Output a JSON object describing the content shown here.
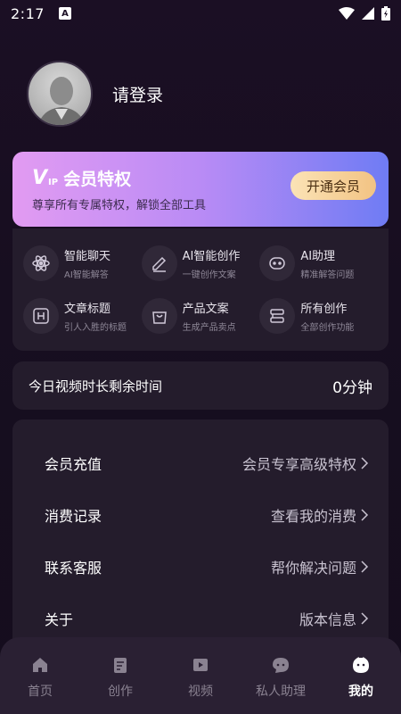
{
  "status_bar": {
    "time": "2:17",
    "badge": "A"
  },
  "profile": {
    "login_text": "请登录"
  },
  "vip": {
    "logo_v": "V",
    "logo_ip": "IP",
    "title": "会员特权",
    "subtitle": "尊享所有专属特权，解锁全部工具",
    "button": "开通会员",
    "gradient": [
      "#e29bf2",
      "#6f7cf4"
    ]
  },
  "features": [
    {
      "name": "智能聊天",
      "desc": "AI智能解答",
      "icon": "atom-icon"
    },
    {
      "name": "AI智能创作",
      "desc": "一键创作文案",
      "icon": "pencil-icon"
    },
    {
      "name": "AI助理",
      "desc": "精准解答问题",
      "icon": "robot-icon"
    },
    {
      "name": "文章标题",
      "desc": "引人入胜的标题",
      "icon": "heading-icon"
    },
    {
      "name": "产品文案",
      "desc": "生成产品卖点",
      "icon": "shopping-bag-icon"
    },
    {
      "name": "所有创作",
      "desc": "全部创作功能",
      "icon": "stack-icon"
    }
  ],
  "video_time": {
    "label": "今日视频时长剩余时间",
    "value": "0分钟"
  },
  "menu": [
    {
      "label": "会员充值",
      "value": "会员专享高级特权"
    },
    {
      "label": "消费记录",
      "value": "查看我的消费"
    },
    {
      "label": "联系客服",
      "value": "帮你解决问题"
    },
    {
      "label": "关于",
      "value": "版本信息"
    }
  ],
  "tabs": [
    {
      "label": "首页",
      "icon": "home-icon",
      "active": false
    },
    {
      "label": "创作",
      "icon": "document-icon",
      "active": false
    },
    {
      "label": "视频",
      "icon": "video-icon",
      "active": false
    },
    {
      "label": "私人助理",
      "icon": "chat-bubble-icon",
      "active": false
    },
    {
      "label": "我的",
      "icon": "profile-face-icon",
      "active": true
    }
  ]
}
